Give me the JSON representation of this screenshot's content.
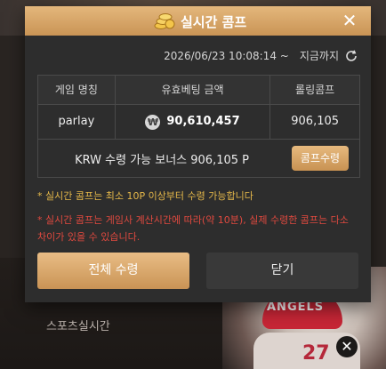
{
  "popup": {
    "title": "실시간 콤프",
    "close_symbol": "✕",
    "timestamp": "2026/06/23 10:08:14 ~",
    "timestamp_suffix": "지금까지",
    "table": {
      "headers": [
        "게임 명칭",
        "유효베팅 금액",
        "롤링콤프"
      ],
      "rows": [
        {
          "game": "parlay",
          "currency_icon": "₩",
          "bet_amount": "90,610,457",
          "rolling_comp": "906,105"
        }
      ]
    },
    "bonus": {
      "text": "KRW 수령 가능 보너스 906,105 P",
      "claim_label": "콤프수령"
    },
    "notes": {
      "min_claim": "* 실시간 콤프는 최소 10P 이상부터 수령 가능합니다",
      "warning": "* 실시간 콤프는 게임사 계산시간에 따라(약 10분), 실제 수령한 콤프는 다소 차이가 있을 수 있습니다."
    },
    "buttons": {
      "claim_all": "전체 수령",
      "close": "닫기"
    },
    "icons": {
      "header": "gold-coins-icon",
      "refresh": "refresh-icon",
      "currency": "won-coin-icon"
    },
    "colors": {
      "header": "#c99455",
      "accent_gold": "#e4b77c",
      "note_yellow": "#e5b84a",
      "note_red": "#e0493f",
      "panel": "#2d2d2d"
    }
  },
  "background": {
    "caption": "스포츠실시간",
    "cap_text": "ANGELS",
    "jersey_number": "27",
    "close_symbol": "✕"
  }
}
